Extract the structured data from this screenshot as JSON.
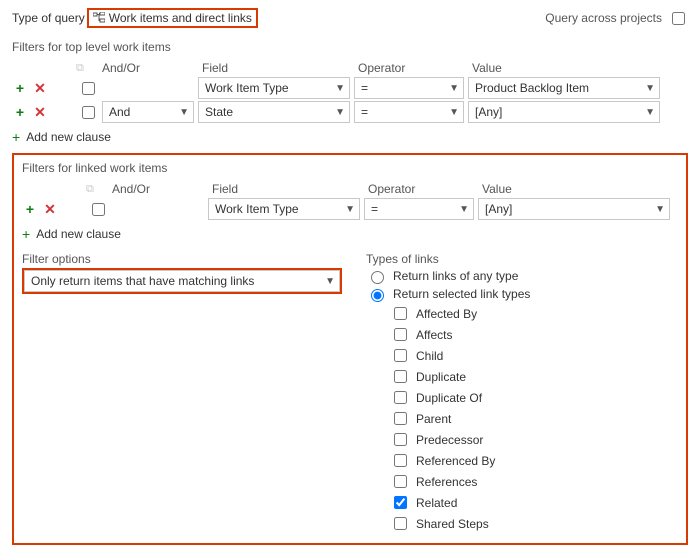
{
  "top": {
    "type_of_query_label": "Type of query",
    "query_type_value": "Work items and direct links",
    "query_across_label": "Query across projects"
  },
  "headers": {
    "andor": "And/Or",
    "field": "Field",
    "operator": "Operator",
    "value": "Value"
  },
  "topFilters": {
    "title": "Filters for top level work items",
    "rows": [
      {
        "andor": "",
        "field": "Work Item Type",
        "op": "=",
        "val": "Product Backlog Item"
      },
      {
        "andor": "And",
        "field": "State",
        "op": "=",
        "val": "[Any]"
      }
    ],
    "add_label": "Add new clause"
  },
  "linkedFilters": {
    "title": "Filters for linked work items",
    "rows": [
      {
        "andor": "",
        "field": "Work Item Type",
        "op": "=",
        "val": "[Any]"
      }
    ],
    "add_label": "Add new clause"
  },
  "filterOptions": {
    "title": "Filter options",
    "value": "Only return items that have matching links"
  },
  "linkTypes": {
    "title": "Types of links",
    "radio_any": "Return links of any type",
    "radio_sel": "Return selected link types",
    "selected_radio": "sel",
    "types": [
      {
        "label": "Affected By",
        "checked": false
      },
      {
        "label": "Affects",
        "checked": false
      },
      {
        "label": "Child",
        "checked": false
      },
      {
        "label": "Duplicate",
        "checked": false
      },
      {
        "label": "Duplicate Of",
        "checked": false
      },
      {
        "label": "Parent",
        "checked": false
      },
      {
        "label": "Predecessor",
        "checked": false
      },
      {
        "label": "Referenced By",
        "checked": false
      },
      {
        "label": "References",
        "checked": false
      },
      {
        "label": "Related",
        "checked": true
      },
      {
        "label": "Shared Steps",
        "checked": false
      }
    ]
  }
}
